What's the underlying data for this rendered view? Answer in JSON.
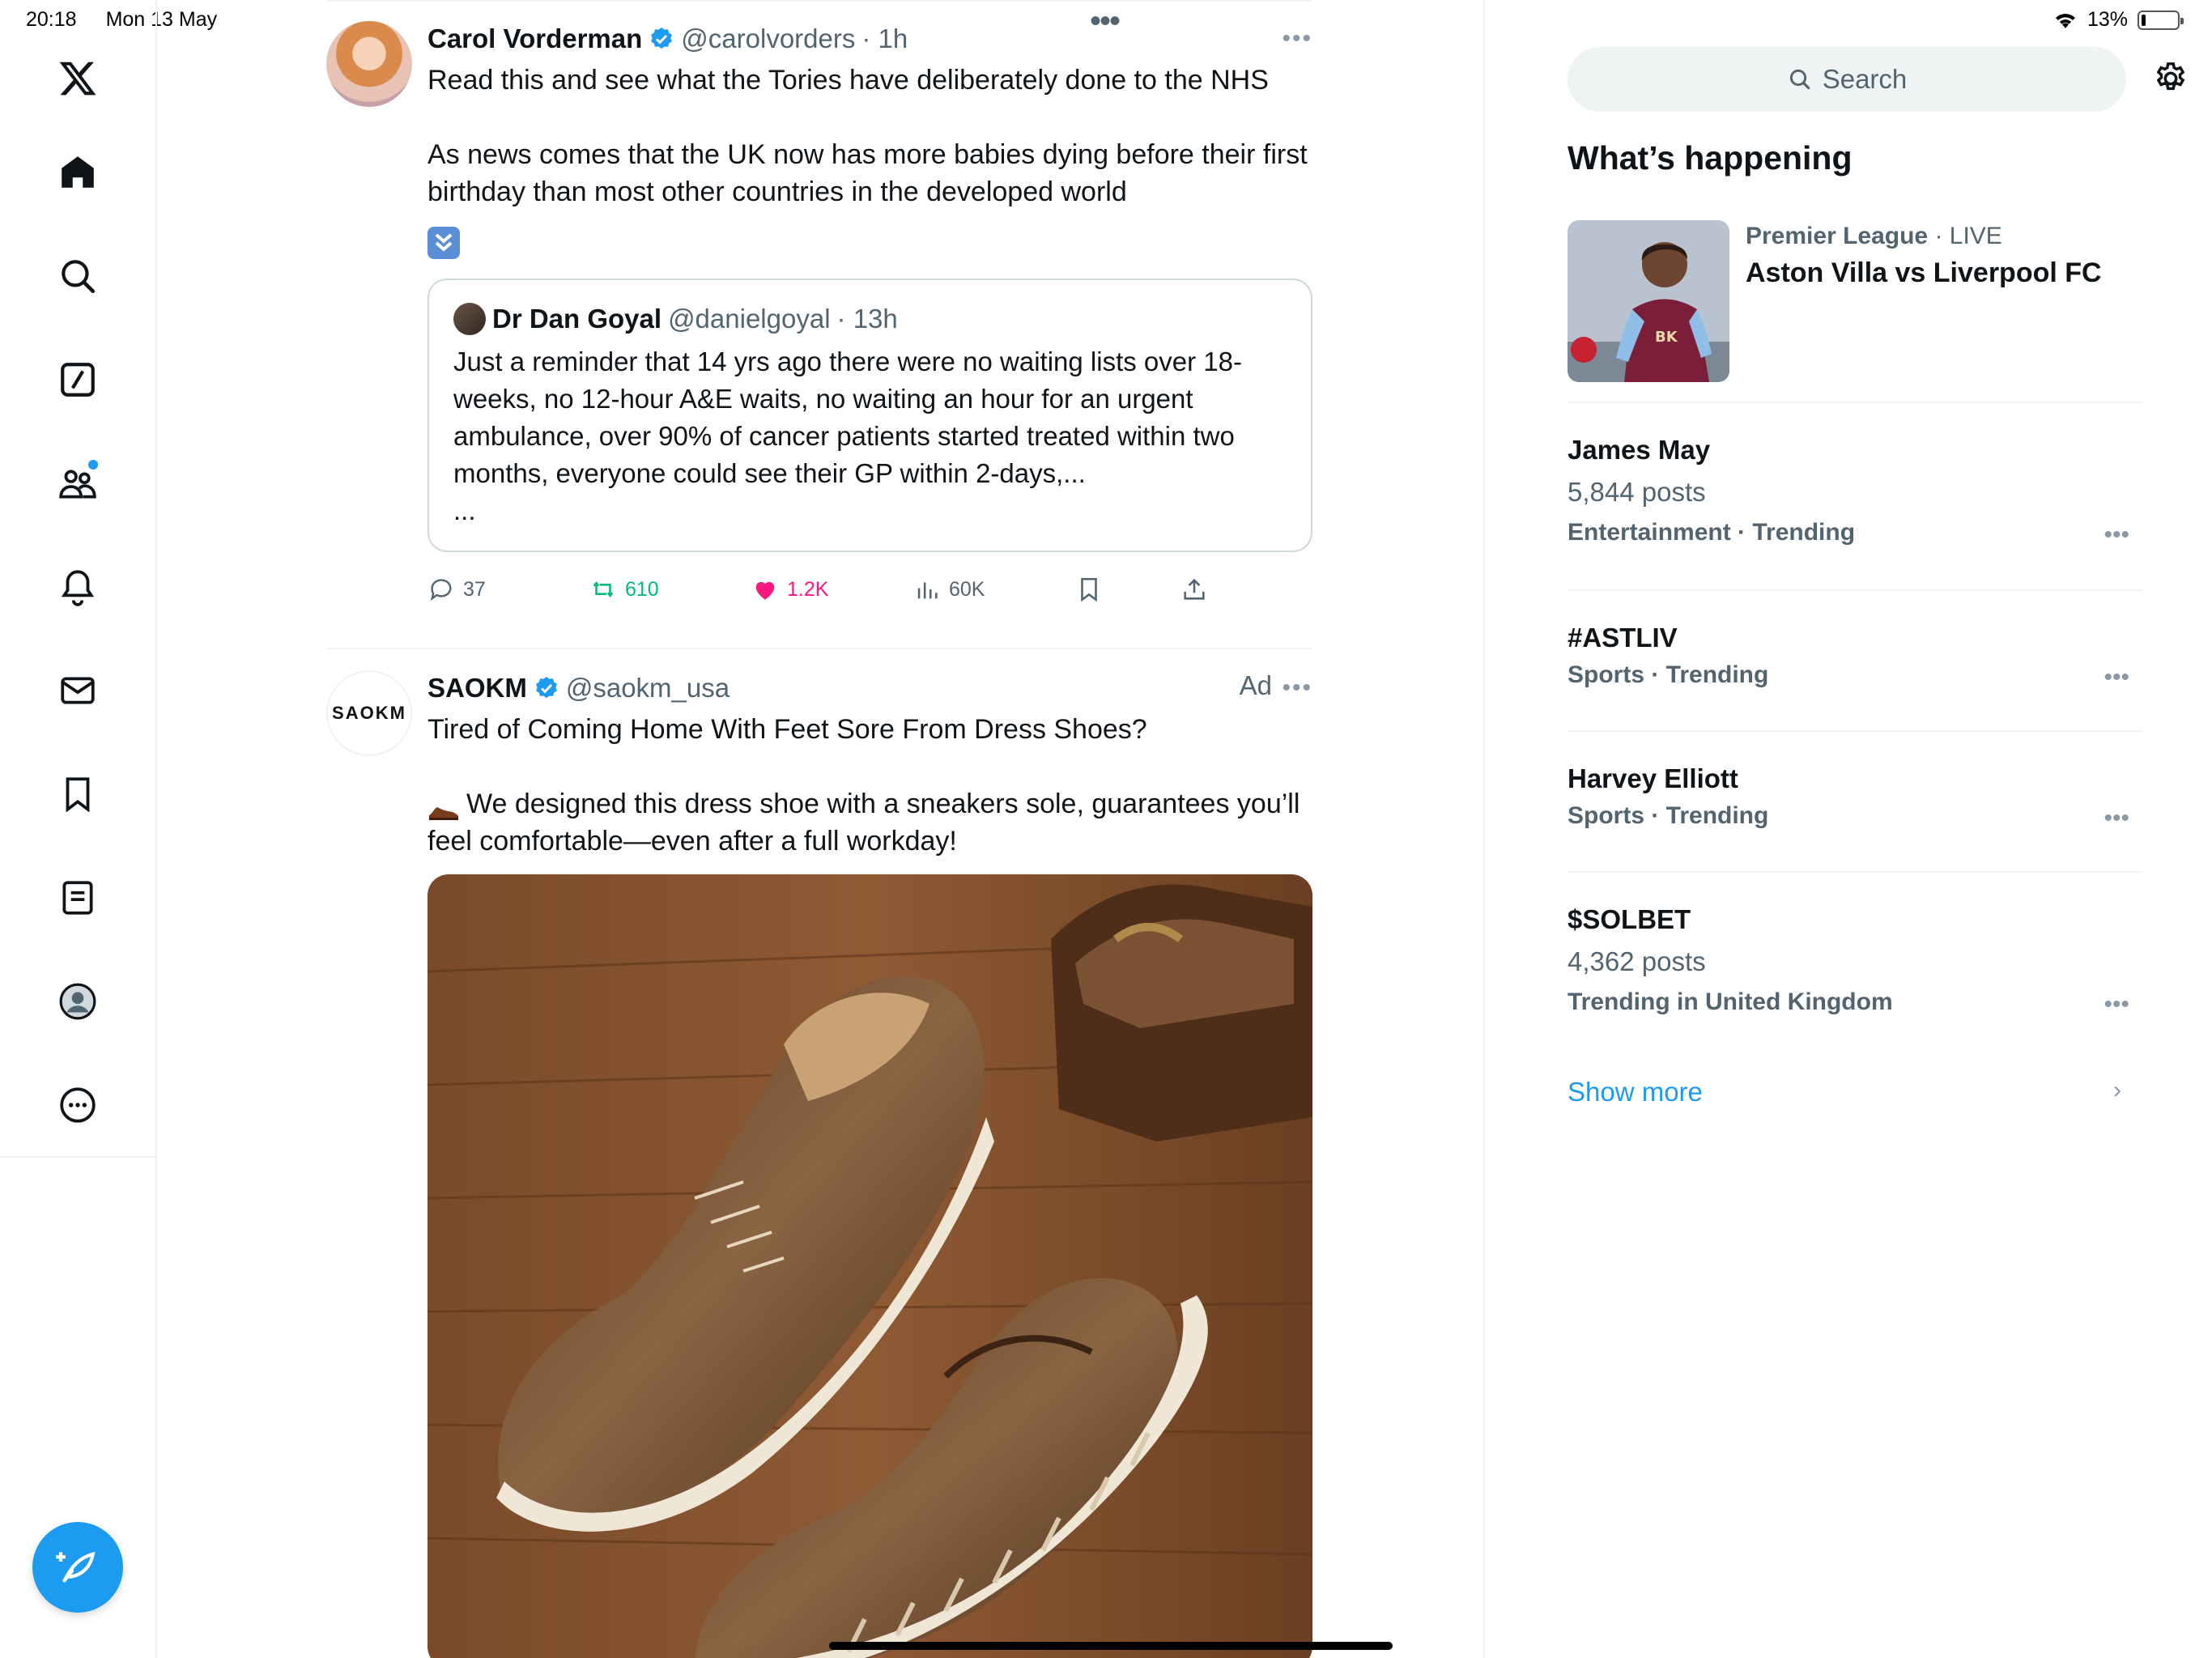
{
  "status_bar": {
    "time": "20:18",
    "date": "Mon 13 May",
    "battery": "13%",
    "battery_level": 0.13
  },
  "nav": {
    "items": [
      {
        "name": "x-logo",
        "icon": "x-logo-icon"
      },
      {
        "name": "home",
        "icon": "home-icon"
      },
      {
        "name": "explore",
        "icon": "search-icon"
      },
      {
        "name": "grok",
        "icon": "grok-icon"
      },
      {
        "name": "communities",
        "icon": "communities-icon"
      },
      {
        "name": "notifications",
        "icon": "bell-icon"
      },
      {
        "name": "messages",
        "icon": "mail-icon"
      },
      {
        "name": "bookmarks",
        "icon": "bookmark-icon"
      },
      {
        "name": "lists",
        "icon": "list-icon"
      },
      {
        "name": "profile",
        "icon": "avatar-icon"
      },
      {
        "name": "more",
        "icon": "more-circle-icon"
      }
    ],
    "compose_icon": "compose-feather-icon"
  },
  "feed": {
    "tweet1": {
      "name": "Carol Vorderman",
      "handle": "@carolvorders",
      "time": "· 1h",
      "text": "Read this and see what the Tories have deliberately done to the NHS\n\nAs news comes that the UK now has more babies dying before their first birthday than most other countries in the developed world",
      "emoji": "double-down-arrow",
      "quote": {
        "name": "Dr Dan Goyal",
        "handle": "@danielgoyal",
        "time": "· 13h",
        "text": "Just a reminder that 14 yrs ago there were no waiting lists over 18-weeks, no 12-hour A&E waits, no waiting an hour for an urgent ambulance, over 90% of cancer patients started treated within two months, everyone could see their GP within 2-days,...\n..."
      },
      "replies": "37",
      "reposts": "610",
      "likes": "1.2K",
      "views": "60K"
    },
    "tweet2": {
      "name": "SAOKM",
      "handle": "@saokm_usa",
      "ad_label": "Ad",
      "avatar_text": "SAOKM",
      "text_line1": "Tired of Coming Home With Feet Sore From Dress Shoes?",
      "text_line2": "We designed this dress shoe with a sneakers sole, guarantees you’ll feel comfortable—even after a full workday!"
    },
    "colors": {
      "repost": "#00ba7c",
      "like": "#f91880",
      "accent": "#1d9bf0"
    }
  },
  "sidebar": {
    "search_placeholder": "Search",
    "section_title": "What’s happening",
    "featured": {
      "category": "Premier League",
      "live": "· LIVE",
      "title": "Aston Villa vs Liverpool FC"
    },
    "trends": [
      {
        "title": "James May",
        "posts": "5,844 posts",
        "context": "Entertainment · Trending"
      },
      {
        "title": "#ASTLIV",
        "context": "Sports · Trending"
      },
      {
        "title": "Harvey Elliott",
        "context": "Sports · Trending"
      },
      {
        "title": "$SOLBET",
        "posts": "4,362 posts",
        "context": "Trending in United Kingdom"
      }
    ],
    "show_more": "Show more"
  }
}
